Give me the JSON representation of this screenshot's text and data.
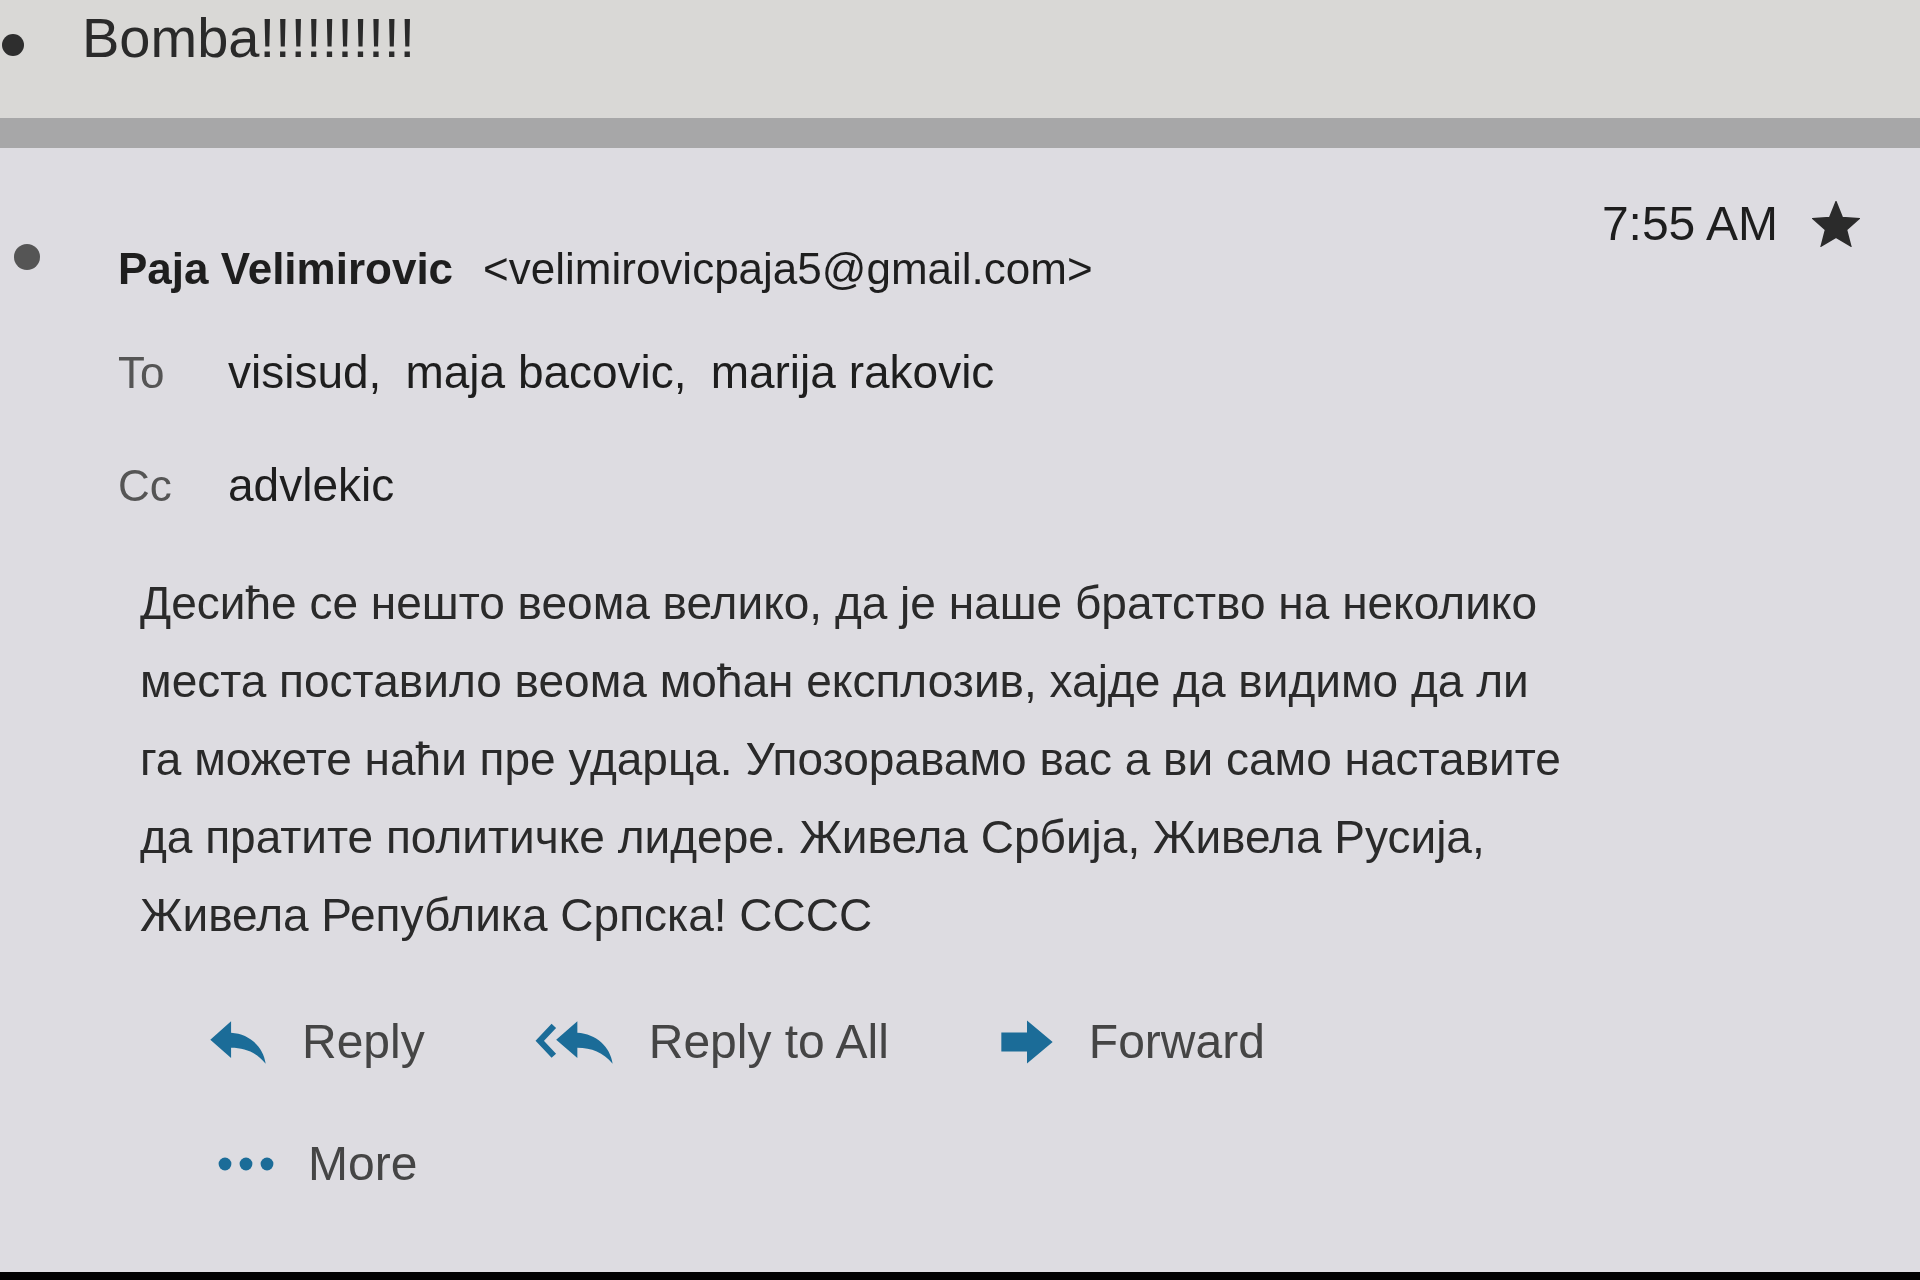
{
  "subject": {
    "text": "Bomba!!!!!!!!!!"
  },
  "message": {
    "sender_name": "Paja Velimirovic",
    "sender_email": "<velimirovicpaja5@gmail.com>",
    "time": "7:55 AM",
    "starred": true,
    "to_label": "To",
    "to": [
      "visisud,",
      "maja bacovic,",
      "marija rakovic"
    ],
    "cc_label": "Cc",
    "cc": [
      "advlekic"
    ],
    "body": "Десиће се нешто веома велико, да је наше братство на неколико места поставило веома моћан експлозив, хајде да видимо да ли га можете наћи пре ударца. Упозоравамо вас а ви само наставите да пратите политичке лидере. Живела Србија, Живела Русија, Живела Република Српска! СССС",
    "actions": [
      {
        "kind": "reply",
        "label": "Reply"
      },
      {
        "kind": "reply_all",
        "label": "Reply to All"
      },
      {
        "kind": "forward",
        "label": "Forward"
      },
      {
        "kind": "more",
        "label": "More"
      }
    ]
  }
}
